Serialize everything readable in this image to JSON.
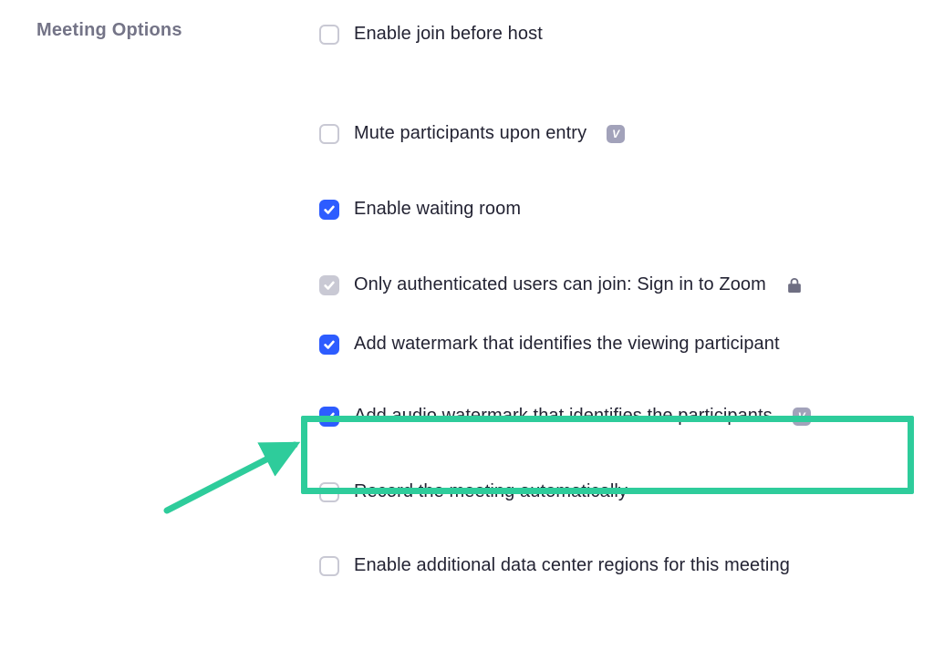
{
  "section": {
    "label": "Meeting Options"
  },
  "options": [
    {
      "label": "Enable join before host",
      "checked": false,
      "locked": false,
      "info": false
    },
    {
      "label": "Mute participants upon entry",
      "checked": false,
      "locked": false,
      "info": true
    },
    {
      "label": "Enable waiting room",
      "checked": true,
      "locked": false,
      "info": false
    },
    {
      "label": "Only authenticated users can join: Sign in to Zoom",
      "checked": true,
      "locked": true,
      "info": false
    },
    {
      "label": "Add watermark that identifies the viewing participant",
      "checked": true,
      "locked": false,
      "info": false
    },
    {
      "label": "Add audio watermark that identifies the participants",
      "checked": true,
      "locked": false,
      "info": true
    },
    {
      "label": "Record the meeting automatically",
      "checked": false,
      "locked": false,
      "info": false
    },
    {
      "label": "Enable additional data center regions for this meeting",
      "checked": false,
      "locked": false,
      "info": false
    }
  ],
  "annotation": {
    "highlight_color": "#2ECC9B",
    "arrow_color": "#2ECC9B",
    "highlighted_option_index": 5
  }
}
